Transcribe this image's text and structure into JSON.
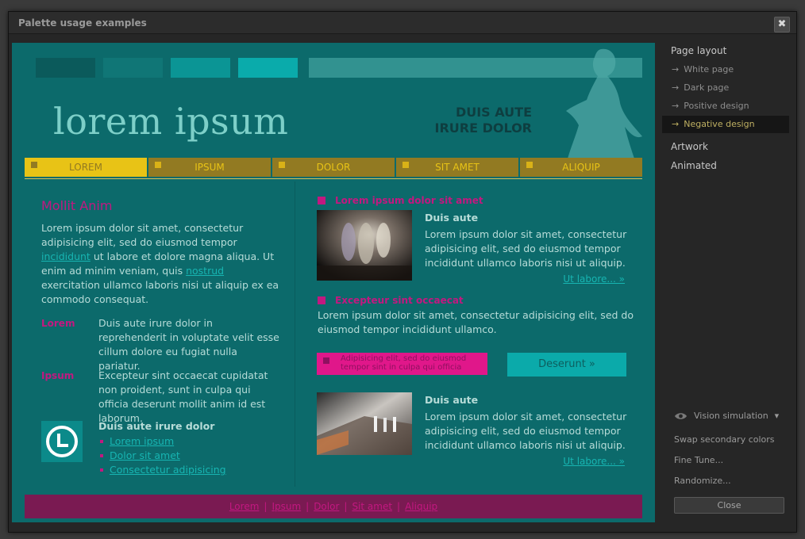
{
  "window": {
    "title": "Palette usage examples",
    "close_symbol": "✖"
  },
  "colors": {
    "page_bg": "#0c6a6b",
    "accent_yellow": "#e8c316",
    "accent_magenta": "#c21880",
    "accent_cyan": "#0baaaa",
    "swatches": [
      "#0b5a5b",
      "#107676",
      "#0b9595",
      "#0aabab"
    ]
  },
  "preview": {
    "logo": "lorem ipsum",
    "tagline": [
      "DUIS AUTE",
      "IRURE DOLOR"
    ],
    "nav": [
      {
        "label": "LOREM",
        "active": true
      },
      {
        "label": "IPSUM",
        "active": false
      },
      {
        "label": "DOLOR",
        "active": false
      },
      {
        "label": "SIT AMET",
        "active": false
      },
      {
        "label": "ALIQUIP",
        "active": false
      }
    ],
    "left": {
      "heading": "Mollit Anim",
      "para_a": "Lorem ipsum dolor sit amet, consectetur adipisicing elit, sed do eiusmod tempor",
      "link_incididunt": "incididunt",
      "para_b": "ut labore et dolore magna aliqua. Ut enim ad minim veniam, quis",
      "link_nostrud": "nostrud",
      "para_c": "exercitation ullamco laboris nisi ut aliquip ex ea commodo consequat.",
      "def1_term": "Lorem",
      "def1_text": "Duis aute irure dolor in reprehenderit in voluptate velit esse cillum dolore eu fugiat nulla pariatur.",
      "def2_term": "Ipsum",
      "def2_text": "Excepteur sint occaecat cupidatat non proident, sunt in culpa qui officia deserunt mollit anim id est laborum.",
      "list_title": "Duis aute irure dolor",
      "list": [
        "Lorem ipsum",
        "Dolor sit amet",
        "Consectetur adipisicing"
      ]
    },
    "right": {
      "heading1": "Lorem ipsum dolor sit amet",
      "card1_title": "Duis aute",
      "card1_text": "Lorem ipsum dolor sit amet, consectetur adipisicing elit, sed do eiusmod tempor incididunt ullamco laboris nisi ut aliquip.",
      "card1_more": "Ut labore... »",
      "heading2": "Excepteur sint occaecat",
      "wide_text": "Lorem ipsum dolor sit amet, consectetur adipisicing elit, sed do eiusmod tempor incididunt ullamco.",
      "note_box": "Adipisicing elit, sed do eiusmod tempor sint in culpa qui officia",
      "button": "Deserunt »",
      "card2_title": "Duis aute",
      "card2_text": "Lorem ipsum dolor sit amet, consectetur adipisicing elit, sed do eiusmod tempor incididunt ullamco laboris nisi ut aliquip.",
      "card2_more": "Ut labore... »"
    },
    "footer": [
      "Lorem",
      "Ipsum",
      "Dolor",
      "Sit amet",
      "Aliquip"
    ],
    "footer_sep": "|"
  },
  "sidebar": {
    "page_layout": "Page layout",
    "items": [
      {
        "label": "White page",
        "selected": false
      },
      {
        "label": "Dark page",
        "selected": false
      },
      {
        "label": "Positive design",
        "selected": false
      },
      {
        "label": "Negative design",
        "selected": true
      }
    ],
    "arrow": "→",
    "artwork": "Artwork",
    "animated": "Animated",
    "vision": "Vision simulation",
    "vision_caret": "▾",
    "swap": "Swap secondary colors",
    "fine_tune": "Fine Tune...",
    "randomize": "Randomize...",
    "close": "Close"
  }
}
